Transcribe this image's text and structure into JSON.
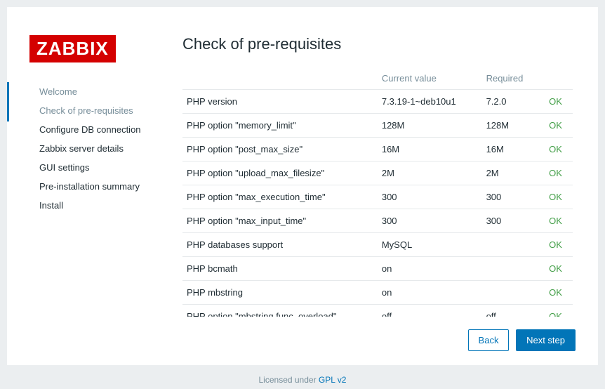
{
  "logo_text": "ZABBIX",
  "nav": {
    "items": [
      {
        "label": "Welcome",
        "state": "completed"
      },
      {
        "label": "Check of pre-requisites",
        "state": "active"
      },
      {
        "label": "Configure DB connection",
        "state": ""
      },
      {
        "label": "Zabbix server details",
        "state": ""
      },
      {
        "label": "GUI settings",
        "state": ""
      },
      {
        "label": "Pre-installation summary",
        "state": ""
      },
      {
        "label": "Install",
        "state": ""
      }
    ]
  },
  "page_title": "Check of pre-requisites",
  "table": {
    "headers": {
      "name": "",
      "current": "Current value",
      "required": "Required",
      "status": ""
    },
    "rows": [
      {
        "name": "PHP version",
        "current": "7.3.19-1~deb10u1",
        "required": "7.2.0",
        "status": "OK"
      },
      {
        "name": "PHP option \"memory_limit\"",
        "current": "128M",
        "required": "128M",
        "status": "OK"
      },
      {
        "name": "PHP option \"post_max_size\"",
        "current": "16M",
        "required": "16M",
        "status": "OK"
      },
      {
        "name": "PHP option \"upload_max_filesize\"",
        "current": "2M",
        "required": "2M",
        "status": "OK"
      },
      {
        "name": "PHP option \"max_execution_time\"",
        "current": "300",
        "required": "300",
        "status": "OK"
      },
      {
        "name": "PHP option \"max_input_time\"",
        "current": "300",
        "required": "300",
        "status": "OK"
      },
      {
        "name": "PHP databases support",
        "current": "MySQL",
        "required": "",
        "status": "OK"
      },
      {
        "name": "PHP bcmath",
        "current": "on",
        "required": "",
        "status": "OK"
      },
      {
        "name": "PHP mbstring",
        "current": "on",
        "required": "",
        "status": "OK"
      },
      {
        "name": "PHP option \"mbstring.func_overload\"",
        "current": "off",
        "required": "off",
        "status": "OK"
      }
    ]
  },
  "buttons": {
    "back": "Back",
    "next": "Next step"
  },
  "footer": {
    "text": "Licensed under ",
    "link": "GPL v2"
  }
}
